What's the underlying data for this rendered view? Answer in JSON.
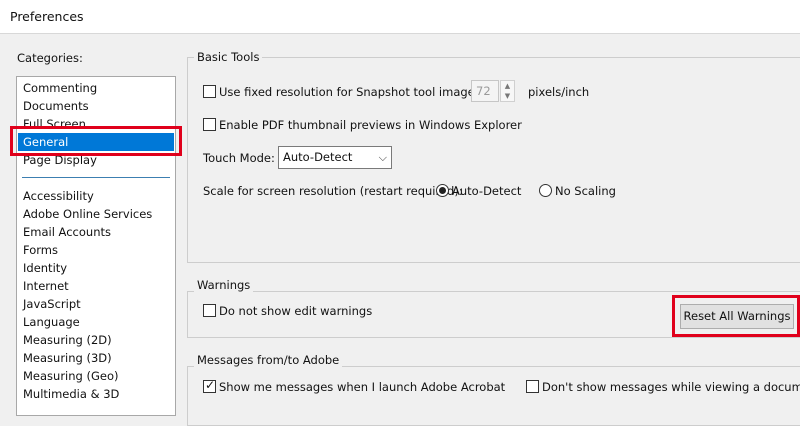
{
  "window": {
    "title": "Preferences"
  },
  "categories": {
    "label": "Categories:",
    "top_items": [
      "Commenting",
      "Documents",
      "Full Screen",
      "General",
      "Page Display"
    ],
    "selected": "General",
    "items": [
      "Accessibility",
      "Adobe Online Services",
      "Email Accounts",
      "Forms",
      "Identity",
      "Internet",
      "JavaScript",
      "Language",
      "Measuring (2D)",
      "Measuring (3D)",
      "Measuring (Geo)",
      "Multimedia & 3D"
    ]
  },
  "basic_tools": {
    "title": "Basic Tools",
    "fixed_resolution_label": "Use fixed resolution for Snapshot tool images:",
    "fixed_resolution_checked": false,
    "resolution_value": "72",
    "resolution_unit": "pixels/inch",
    "thumbnail_label": "Enable PDF thumbnail previews in Windows Explorer",
    "thumbnail_checked": false,
    "touch_mode_label": "Touch Mode:",
    "touch_mode_value": "Auto-Detect",
    "scale_label": "Scale for screen resolution (restart required):",
    "scale_option_auto": "Auto-Detect",
    "scale_option_none": "No Scaling",
    "scale_selected": "Auto-Detect"
  },
  "warnings": {
    "title": "Warnings",
    "edit_warnings_label": "Do not show edit warnings",
    "edit_warnings_checked": false,
    "reset_button": "Reset All Warnings"
  },
  "messages": {
    "title": "Messages from/to Adobe",
    "show_messages_label": "Show me messages when I launch Adobe Acrobat",
    "show_messages_checked": true,
    "dont_show_label": "Don't show messages while viewing a document",
    "dont_show_checked": false
  },
  "colors": {
    "selection": "#0078d7",
    "highlight": "#e0001b"
  }
}
